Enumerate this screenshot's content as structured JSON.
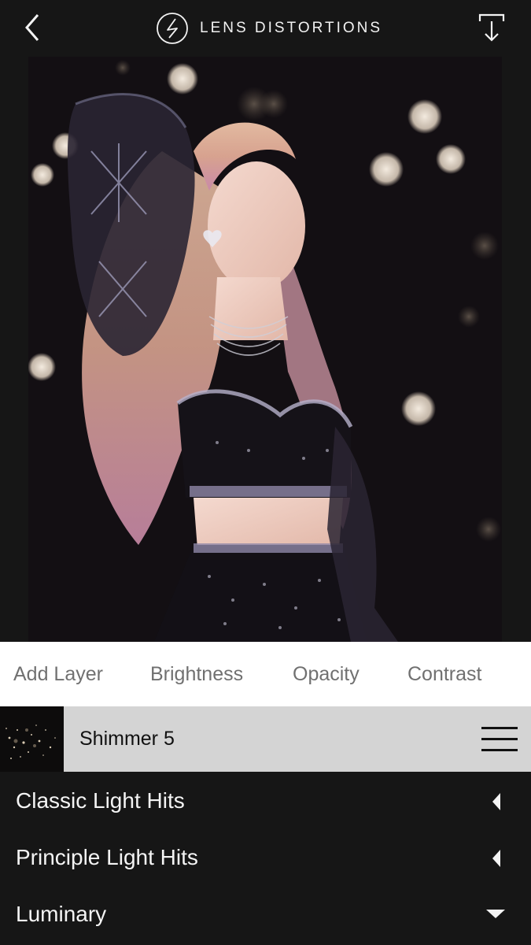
{
  "header": {
    "app_title": "LENS DISTORTIONS",
    "back_icon": "chevron-left-icon",
    "export_icon": "download-arrow-icon"
  },
  "tabs": [
    {
      "label": "Add Layer"
    },
    {
      "label": "Brightness"
    },
    {
      "label": "Opacity"
    },
    {
      "label": "Contrast"
    }
  ],
  "active_layer": {
    "name": "Shimmer 5",
    "menu_icon": "hamburger-menu-icon"
  },
  "categories": [
    {
      "label": "Classic Light Hits",
      "icon": "caret-left-icon",
      "state": "collapsed"
    },
    {
      "label": "Principle Light Hits",
      "icon": "caret-left-icon",
      "state": "collapsed"
    },
    {
      "label": "Luminary",
      "icon": "caret-down-icon",
      "state": "expanded"
    }
  ],
  "colors": {
    "background": "#161616",
    "tab_bar": "#ffffff",
    "tab_text": "#707070",
    "layer_row": "#d4d4d4"
  }
}
